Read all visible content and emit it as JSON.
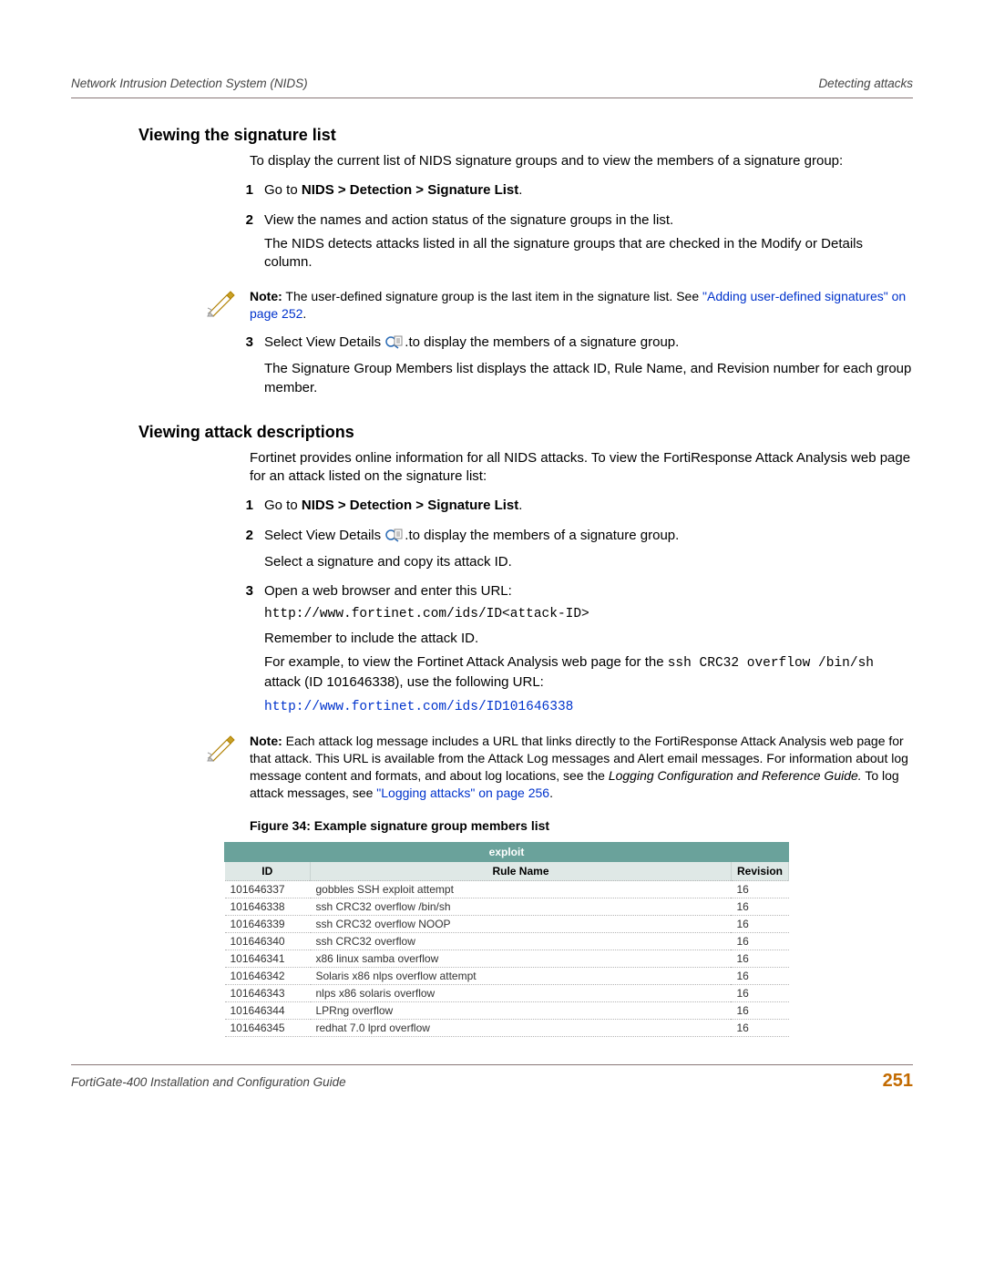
{
  "header": {
    "left": "Network Intrusion Detection System (NIDS)",
    "right": "Detecting attacks"
  },
  "section1": {
    "title": "Viewing the signature list",
    "intro": "To display the current list of NIDS signature groups and to view the members of a signature group:",
    "steps": {
      "s1": {
        "num": "1",
        "prefix": "Go to ",
        "bold": "NIDS > Detection > Signature List",
        "suffix": "."
      },
      "s2": {
        "num": "2",
        "line1": "View the names and action status of the signature groups in the list.",
        "line2": "The NIDS detects attacks listed in all the signature groups that are checked in the Modify or Details column."
      },
      "s3": {
        "num": "3",
        "prefix": "Select View Details ",
        "suffix": ".to display the members of a signature group.",
        "line2": "The Signature Group Members list displays the attack ID, Rule Name, and Revision number for each group member."
      }
    },
    "note": {
      "label": "Note:",
      "text": " The user-defined signature group is the last item in the signature list. See ",
      "link": "\"Adding user-defined signatures\" on page 252",
      "tail": "."
    }
  },
  "section2": {
    "title": "Viewing attack descriptions",
    "intro": "Fortinet provides online information for all NIDS attacks. To view the FortiResponse Attack Analysis web page for an attack listed on the signature list:",
    "steps": {
      "s1": {
        "num": "1",
        "prefix": "Go to ",
        "bold": "NIDS > Detection > Signature List",
        "suffix": "."
      },
      "s2": {
        "num": "2",
        "prefix": "Select View Details ",
        "suffix": ".to display the members of a signature group.",
        "line2": "Select a signature and copy its attack ID."
      },
      "s3": {
        "num": "3",
        "line1": "Open a web browser and enter this URL:",
        "url1": "http://www.fortinet.com/ids/ID<attack-ID>",
        "line2": "Remember to include the attack ID.",
        "ex_prefix": "For example, to view the Fortinet Attack Analysis web page for the ",
        "ex_mono1": "ssh CRC32 overflow /bin/sh",
        "ex_mid": " attack (ID 101646338), use the following URL:",
        "url2": "http://www.fortinet.com/ids/ID101646338"
      }
    },
    "note": {
      "label": "Note:",
      "text1": " Each attack log message includes a URL that links directly to the FortiResponse Attack Analysis web page for that attack. This URL is available from the Attack Log messages and Alert email messages. For information about log message content and formats, and about log locations, see the ",
      "italic": "Logging Configuration and Reference Guide.",
      "text2": " To log attack messages, see ",
      "link": "\"Logging attacks\" on page 256",
      "tail": "."
    }
  },
  "figure": {
    "caption": "Figure 34: Example signature group members list",
    "group": "exploit",
    "cols": {
      "id": "ID",
      "rule": "Rule Name",
      "rev": "Revision"
    },
    "rows": [
      {
        "id": "101646337",
        "rule": "gobbles SSH exploit attempt",
        "rev": "16"
      },
      {
        "id": "101646338",
        "rule": "ssh CRC32 overflow /bin/sh",
        "rev": "16"
      },
      {
        "id": "101646339",
        "rule": "ssh CRC32 overflow NOOP",
        "rev": "16"
      },
      {
        "id": "101646340",
        "rule": "ssh CRC32 overflow",
        "rev": "16"
      },
      {
        "id": "101646341",
        "rule": "x86 linux samba overflow",
        "rev": "16"
      },
      {
        "id": "101646342",
        "rule": "Solaris x86 nlps overflow attempt",
        "rev": "16"
      },
      {
        "id": "101646343",
        "rule": "nlps x86 solaris overflow",
        "rev": "16"
      },
      {
        "id": "101646344",
        "rule": "LPRng overflow",
        "rev": "16"
      },
      {
        "id": "101646345",
        "rule": "redhat 7.0 lprd overflow",
        "rev": "16"
      }
    ]
  },
  "footer": {
    "left": "FortiGate-400 Installation and Configuration Guide",
    "page": "251"
  }
}
